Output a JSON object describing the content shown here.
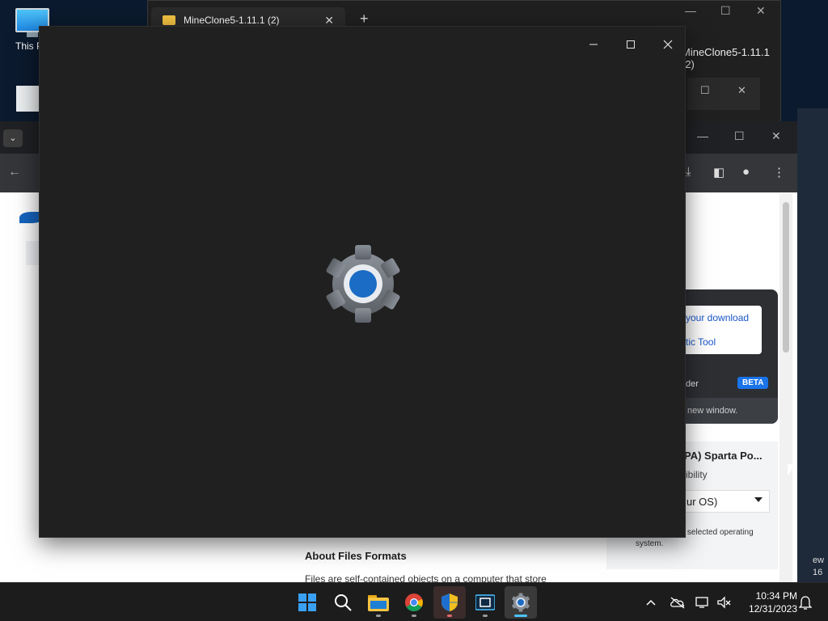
{
  "desktop": {
    "icon_label": "This PC"
  },
  "explorer": {
    "tab_title": "MineClone5-1.11.1 (2)",
    "tab_close": "✕",
    "new_tab": "+",
    "window_title": "MineClone5-1.11.1 (2)"
  },
  "browser": {
    "popup": {
      "link1": "your download",
      "link2": "tic Tool",
      "feature_label": "der",
      "beta_badge": "BETA",
      "footer": "new window."
    },
    "os_card": {
      "heading": "PA) Sparta Po...",
      "subheading": "ibility",
      "select_value": "ur OS)",
      "note": "atible with the selected operating system."
    },
    "about_heading": "About Files Formats",
    "about_text": "Files are self-contained objects on a computer that store",
    "edge_text_1": "ew",
    "edge_text_2": "16"
  },
  "splash_window": {
    "icon": "settings-gear-icon",
    "accent_color": "#1a6cc4"
  },
  "taskbar": {
    "apps": [
      {
        "name": "start",
        "icon": "windows-logo-icon"
      },
      {
        "name": "search",
        "icon": "search-icon"
      },
      {
        "name": "file-explorer",
        "icon": "folder-icon"
      },
      {
        "name": "chrome",
        "icon": "chrome-icon"
      },
      {
        "name": "security",
        "icon": "shield-icon"
      },
      {
        "name": "clipchamp",
        "icon": "film-icon"
      },
      {
        "name": "settings",
        "icon": "gear-icon"
      }
    ],
    "time": "10:34 PM",
    "date": "12/31/2023"
  }
}
